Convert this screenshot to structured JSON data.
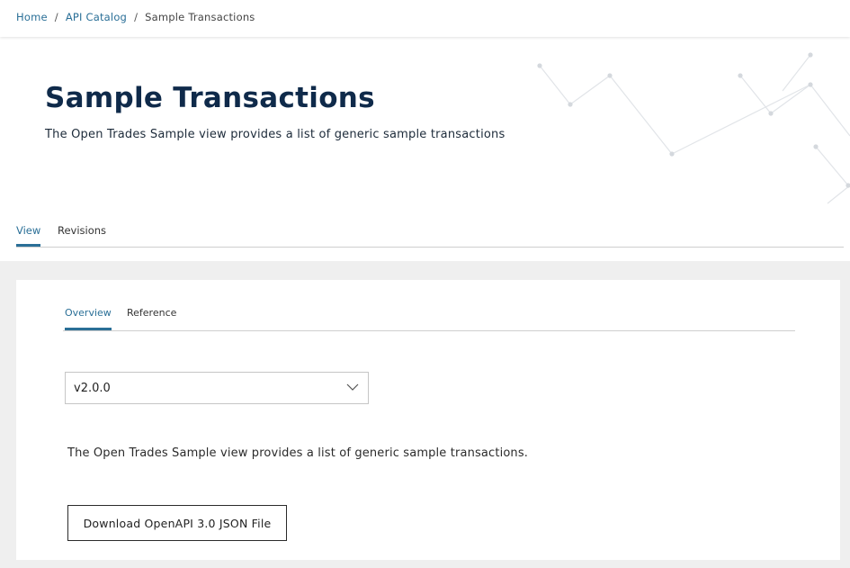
{
  "breadcrumb": {
    "items": [
      {
        "label": "Home"
      },
      {
        "label": "API Catalog"
      },
      {
        "label": "Sample Transactions"
      }
    ],
    "separator": "/"
  },
  "header": {
    "title": "Sample Transactions",
    "subtitle": "The Open Trades Sample view provides a list of generic sample transactions"
  },
  "main_tabs": [
    {
      "label": "View",
      "active": true
    },
    {
      "label": "Revisions",
      "active": false
    }
  ],
  "sub_tabs": [
    {
      "label": "Overview",
      "active": true
    },
    {
      "label": "Reference",
      "active": false
    }
  ],
  "version_select": {
    "selected": "v2.0.0",
    "icon": "chevron-down-icon"
  },
  "description": "The Open Trades Sample view provides a list of generic sample transactions.",
  "download_button": {
    "label": "Download OpenAPI 3.0 JSON File"
  },
  "colors": {
    "accent": "#2a6f97",
    "title": "#0f2a4a",
    "content_background": "#efefef"
  }
}
